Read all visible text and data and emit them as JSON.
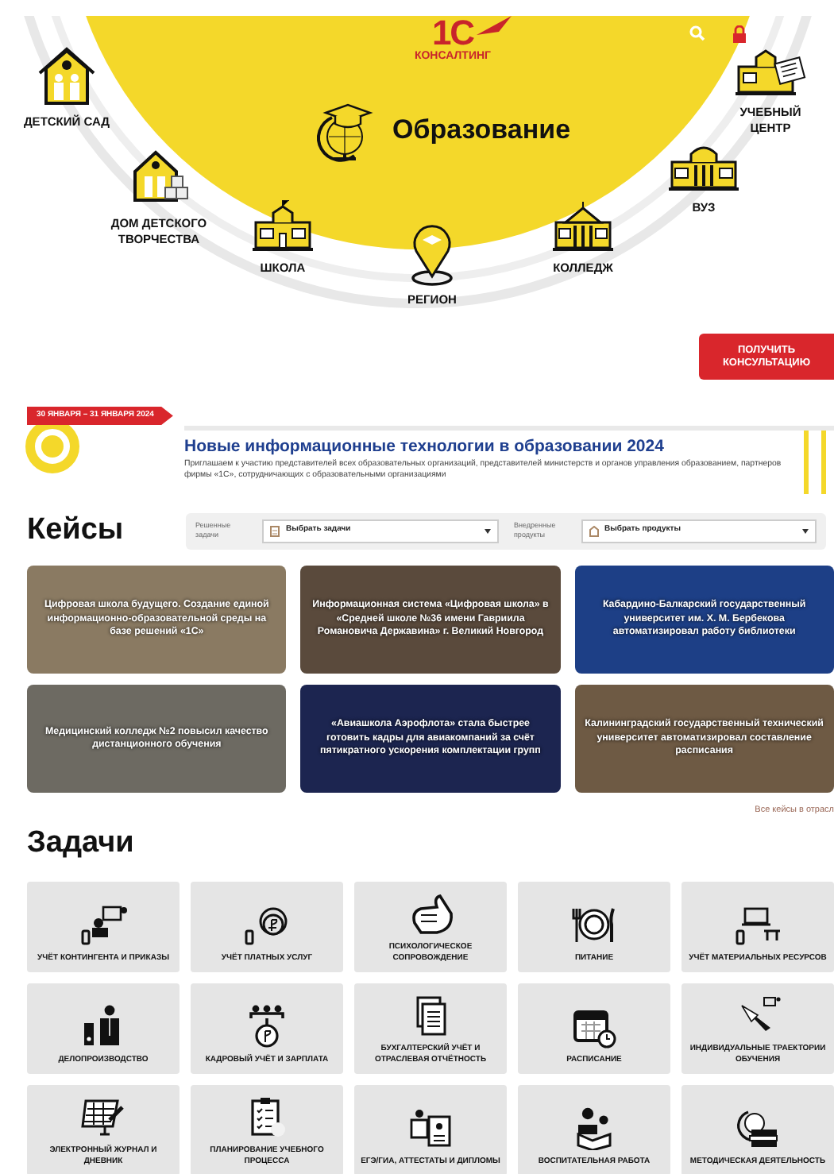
{
  "header": {
    "logo": {
      "mark": "1С",
      "caption": "КОНСАЛТИНГ"
    },
    "title": "Образование",
    "categories": [
      {
        "label": "ДЕТСКИЙ САД"
      },
      {
        "label": "ДОМ ДЕТСКОГО ТВОРЧЕСТВА"
      },
      {
        "label": "ШКОЛА"
      },
      {
        "label": "РЕГИОН"
      },
      {
        "label": "КОЛЛЕДЖ"
      },
      {
        "label": "ВУЗ"
      },
      {
        "label": "УЧЕБНЫЙ ЦЕНТР"
      }
    ],
    "cta": "ПОЛУЧИТЬ КОНСУЛЬТАЦИЮ"
  },
  "event": {
    "date": "30 ЯНВАРЯ – 31 ЯНВАРЯ 2024",
    "title": "Новые информационные технологии в образовании 2024",
    "description": "Приглашаем к участию представителей всех образовательных организаций, представителей министерств и органов управления образованием, партнеров фирмы «1С», сотрудничающих с образовательными организациями"
  },
  "cases": {
    "heading": "Кейсы",
    "filters": [
      {
        "label": "Решенные задачи",
        "placeholder": "Выбрать задачи"
      },
      {
        "label": "Внедренные продукты",
        "placeholder": "Выбрать продукты"
      }
    ],
    "items": [
      {
        "title": "Цифровая школа будущего. Создание единой информационно-образовательной среды на базе решений «1С»",
        "color": "#8a7a62"
      },
      {
        "title": "Информационная система «Цифровая школа» в «Средней школе №36 имени Гавриила Романовича Державина» г. Великий Новгород",
        "color": "#5a4a3c"
      },
      {
        "title": "Кабардино-Балкарский государственный университет им. Х. М. Бербекова автоматизировал работу библиотеки",
        "color": "#1d3f86"
      },
      {
        "title": "Медицинский колледж №2 повысил качество дистанционного обучения",
        "color": "#6d6a62"
      },
      {
        "title": "«Авиашкола Аэрофлота» стала быстрее готовить кадры для авиакомпаний за счёт пятикратного ускорения комплектации групп",
        "color": "#1c2550"
      },
      {
        "title": "Калининградский государственный технический университет автоматизировал составление расписания",
        "color": "#6e5a44"
      }
    ],
    "more_link": "Все кейсы в отрасл"
  },
  "tasks": {
    "heading": "Задачи",
    "items": [
      {
        "label": "УЧЁТ КОНТИНГЕНТА И ПРИКАЗЫ"
      },
      {
        "label": "УЧЁТ ПЛАТНЫХ УСЛУГ"
      },
      {
        "label": "ПСИХОЛОГИЧЕСКОЕ СОПРОВОЖДЕНИЕ"
      },
      {
        "label": "ПИТАНИЕ"
      },
      {
        "label": "УЧЁТ МАТЕРИАЛЬНЫХ РЕСУРСОВ"
      },
      {
        "label": "ДЕЛОПРОИЗВОДСТВО"
      },
      {
        "label": "КАДРОВЫЙ УЧЁТ И ЗАРПЛАТА"
      },
      {
        "label": "БУХГАЛТЕРСКИЙ УЧЁТ И ОТРАСЛЕВАЯ ОТЧЁТНОСТЬ"
      },
      {
        "label": "РАСПИСАНИЕ"
      },
      {
        "label": "ИНДИВИДУАЛЬНЫЕ ТРАЕКТОРИИ ОБУЧЕНИЯ"
      },
      {
        "label": "ЭЛЕКТРОННЫЙ ЖУРНАЛ И ДНЕВНИК"
      },
      {
        "label": "ПЛАНИРОВАНИЕ УЧЕБНОГО ПРОЦЕССА"
      },
      {
        "label": "ЕГЭ/ГИА, АТТЕСТАТЫ И ДИПЛОМЫ"
      },
      {
        "label": "ВОСПИТАТЕЛЬНАЯ РАБОТА"
      },
      {
        "label": "МЕТОДИЧЕСКАЯ ДЕЯТЕЛЬНОСТЬ"
      }
    ]
  }
}
